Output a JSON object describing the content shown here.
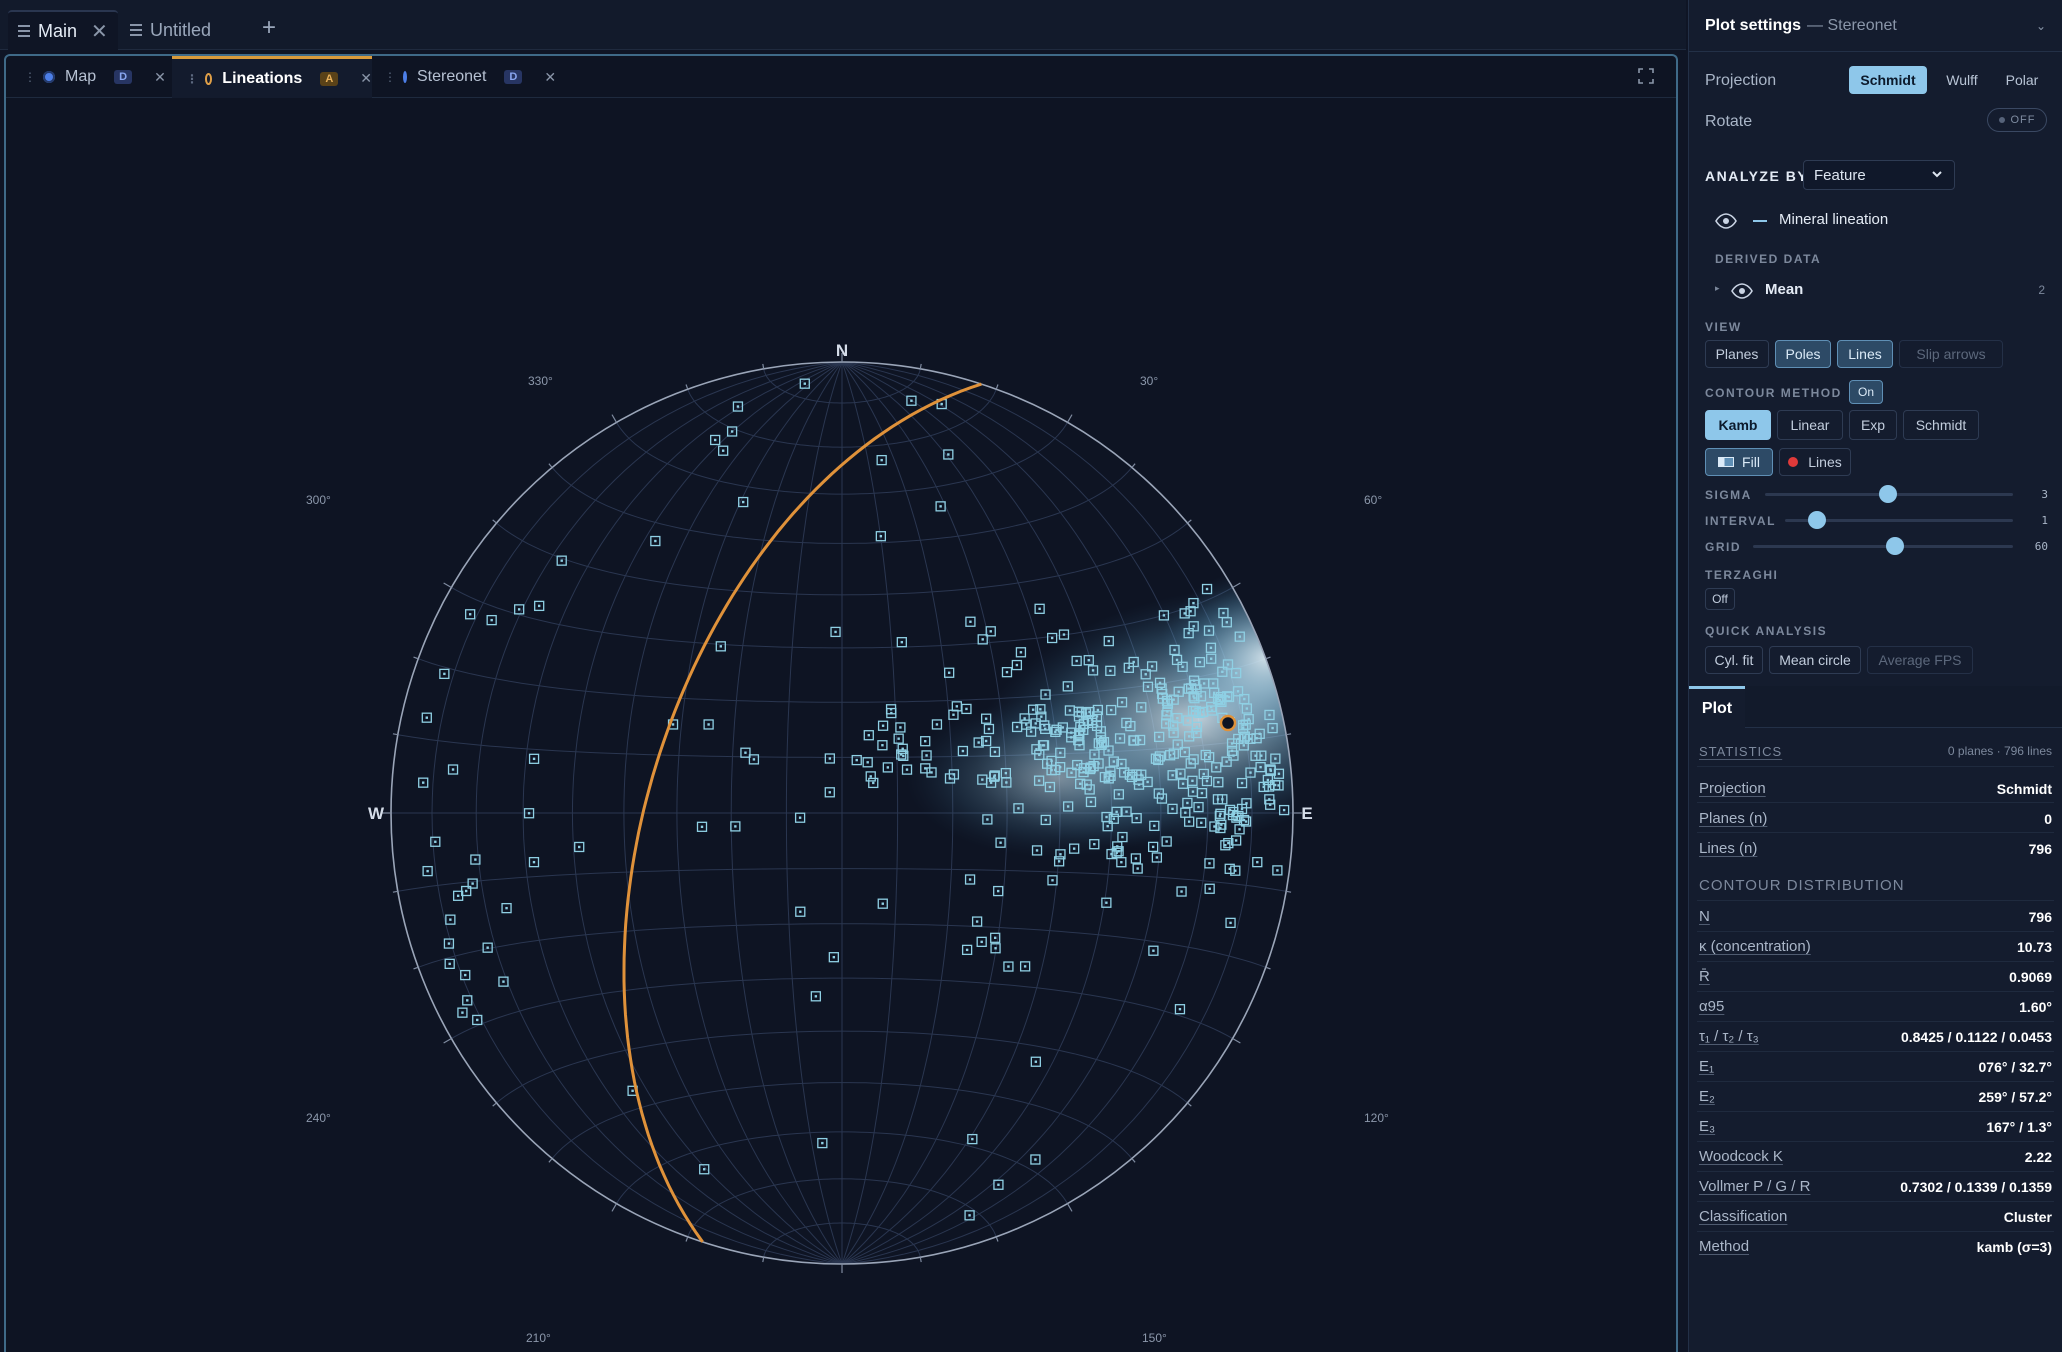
{
  "window_tabs": [
    {
      "label": "Main",
      "active": true
    },
    {
      "label": "Untitled",
      "active": false
    }
  ],
  "panel_tabs": [
    {
      "label": "Map",
      "badge": "D",
      "dot_color": "#4d7fe8"
    },
    {
      "label": "Lineations",
      "badge": "A",
      "dot_color": "#e0a048"
    },
    {
      "label": "Stereonet",
      "badge": "D",
      "dot_color": "#4d7fe8"
    }
  ],
  "stereonet": {
    "cardinals": {
      "n": "N",
      "e": "E",
      "w": "W"
    },
    "azimuth_labels": [
      "330°",
      "30°",
      "300°",
      "60°",
      "240°",
      "120°",
      "210°",
      "150°"
    ],
    "great_circle_color": "#e0923a",
    "pole_color": "#8fd0e4",
    "mean_marker_color": "#e0923a"
  },
  "settings": {
    "title": "Plot settings",
    "subtitle": "— Stereonet",
    "projection_label": "Projection",
    "projection_options": [
      "Schmidt",
      "Wulff",
      "Polar"
    ],
    "projection_selected": "Schmidt",
    "rotate_label": "Rotate",
    "rotate_state": "OFF",
    "analyze_by_label": "ANALYZE BY",
    "analyze_by_value": "Feature",
    "feature_name": "Mineral lineation",
    "derived_label": "DERIVED DATA",
    "derived_item": "Mean",
    "derived_count": "2",
    "view_label": "VIEW",
    "view_options": [
      "Planes",
      "Poles",
      "Lines",
      "Slip arrows"
    ],
    "contour_label": "CONTOUR METHOD",
    "contour_state": "On",
    "contour_methods": [
      "Kamb",
      "Linear",
      "Exp",
      "Schmidt"
    ],
    "fill_label": "Fill",
    "lines_label": "Lines",
    "sigma_label": "SIGMA",
    "sigma_value": "3",
    "interval_label": "INTERVAL",
    "interval_value": "1",
    "grid_label": "GRID",
    "grid_value": "60",
    "terzaghi_label": "TERZAGHI",
    "terzaghi_value": "Off",
    "quick_label": "QUICK ANALYSIS",
    "quick_options": [
      "Cyl. fit",
      "Mean circle",
      "Average FPS"
    ]
  },
  "plot": {
    "tab_label": "Plot",
    "statistics_label": "STATISTICS",
    "statistics_summary": "0 planes · 796 lines",
    "stats": [
      {
        "label": "Projection",
        "value": "Schmidt"
      },
      {
        "label": "Planes (n)",
        "value": "0"
      },
      {
        "label": "Lines (n)",
        "value": "796"
      }
    ],
    "contour_label": "CONTOUR DISTRIBUTION",
    "contour": [
      {
        "label": "N",
        "value": "796"
      },
      {
        "label": "κ (concentration)",
        "value": "10.73"
      },
      {
        "label": "R̄",
        "value": "0.9069"
      },
      {
        "label": "α95",
        "value": "1.60°"
      },
      {
        "label": "τ₁ / τ₂ / τ₃",
        "value": "0.8425 / 0.1122 / 0.0453"
      },
      {
        "label": "E₁",
        "value": "076° / 32.7°"
      },
      {
        "label": "E₂",
        "value": "259° / 57.2°"
      },
      {
        "label": "E₃",
        "value": "167° / 1.3°"
      },
      {
        "label": "Woodcock K",
        "value": "2.22"
      },
      {
        "label": "Vollmer P / G / R",
        "value": "0.7302 / 0.1339 / 0.1359"
      },
      {
        "label": "Classification",
        "value": "Cluster"
      },
      {
        "label": "Method",
        "value": "kamb (σ=3)"
      }
    ]
  }
}
